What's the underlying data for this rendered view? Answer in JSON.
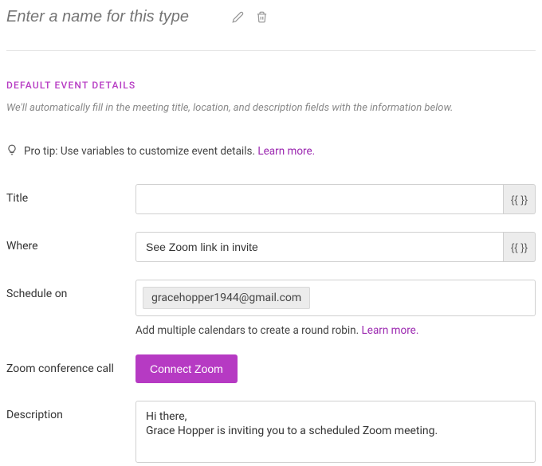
{
  "type_name": {
    "placeholder": "Enter a name for this type"
  },
  "section": {
    "header": "DEFAULT EVENT DETAILS",
    "subtext": "We'll automatically fill in the meeting title, location, and description fields with the information below."
  },
  "tip": {
    "text": "Pro tip: Use variables to customize event details.  ",
    "learn_more": "Learn more."
  },
  "fields": {
    "title": {
      "label": "Title",
      "value": "",
      "var_btn": "{{ }}"
    },
    "where": {
      "label": "Where",
      "value": "See Zoom link in invite",
      "var_btn": "{{ }}"
    },
    "schedule_on": {
      "label": "Schedule on",
      "chip": "gracehopper1944@gmail.com",
      "helper": "Add multiple calendars to create a round robin. ",
      "learn_more": "Learn more."
    },
    "zoom": {
      "label": "Zoom conference call",
      "button": "Connect Zoom"
    },
    "description": {
      "label": "Description",
      "value": "Hi there,\nGrace Hopper is inviting you to a scheduled Zoom meeting."
    }
  }
}
